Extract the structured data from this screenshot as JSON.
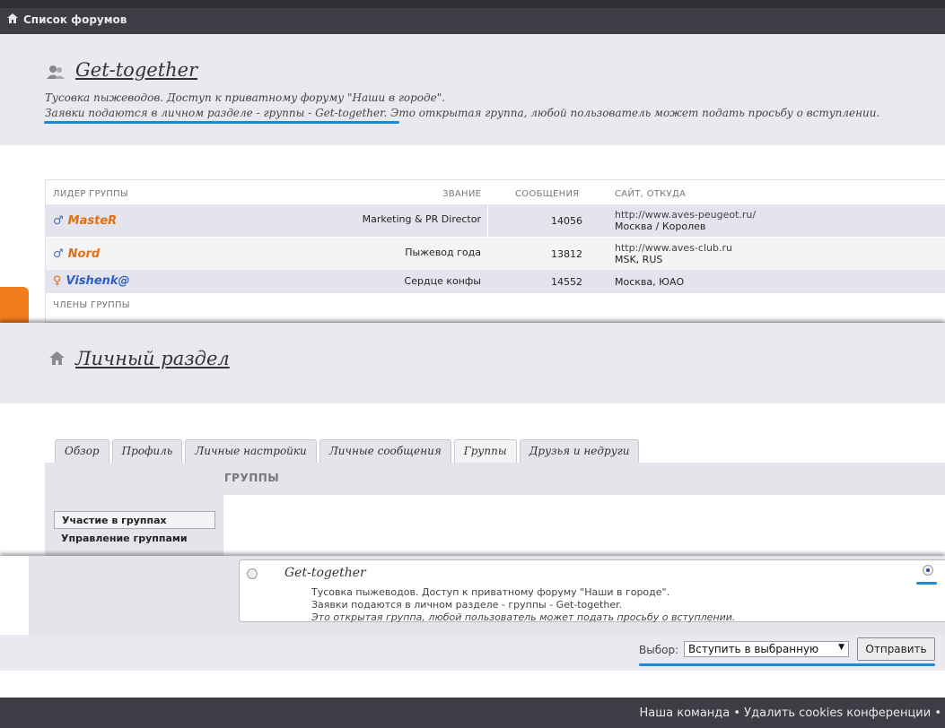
{
  "breadcrumb": {
    "label": "Список форумов"
  },
  "group_page": {
    "title": "Get-together",
    "desc_line1": "Тусовка пыжеводов. Доступ к приватному форуму \"Наши в городе\".",
    "desc_line2_link": "Заявки подаются в личном разделе - группы - Get-together.",
    "desc_line2_rest": " Это открытая группа, любой пользователь может подать просьбу о вступлении.",
    "table": {
      "headers": [
        "ЛИДЕР ГРУППЫ",
        "ЗВАНИЕ",
        "СООБЩЕНИЯ",
        "САЙТ, ОТКУДА"
      ],
      "rows": [
        {
          "gender": "♂",
          "name": "MasteR",
          "rank": "Marketing & PR Director",
          "posts": "14056",
          "site": "http://www.aves-peugeot.ru/",
          "location": "Москва / Королев"
        },
        {
          "gender": "♂",
          "name": "Nord",
          "rank": "Пыжевод года",
          "posts": "13812",
          "site": "http://www.aves-club.ru",
          "location": "MSK, RUS"
        },
        {
          "gender": "♀",
          "name": "Vishenk@",
          "rank": "Сердце конфы",
          "posts": "14552",
          "site": "",
          "location": "Москва, ЮАО"
        }
      ],
      "members_header": "ЧЛЕНЫ ГРУППЫ"
    }
  },
  "personal": {
    "title": "Личный раздел",
    "tabs": [
      "Обзор",
      "Профиль",
      "Личные настройки",
      "Личные сообщения",
      "Группы",
      "Друзья и недруги"
    ],
    "active_tab": "Группы",
    "section_header": "ГРУППЫ",
    "side_items": [
      "Участие в группах",
      "Управление группами"
    ],
    "group_item": {
      "name": "Get-together",
      "line1": "Тусовка пыжеводов. Доступ к приватному форуму \"Наши в городе\".",
      "line2": "Заявки подаются в личном разделе - группы - Get-together.",
      "line3": "Это открытая группа, любой пользователь может подать просьбу о вступлении."
    },
    "form": {
      "label": "Выбор:",
      "select_value": "Вступить в выбранную",
      "submit": "Отправить"
    }
  },
  "footer": {
    "links": "Наша команда • Удалить cookies конференции •"
  },
  "colors": {
    "accent_orange": "#f27d1e",
    "link_blue": "#1e88d8",
    "user_orange": "#e07018",
    "user_blue": "#2f5fc4"
  }
}
